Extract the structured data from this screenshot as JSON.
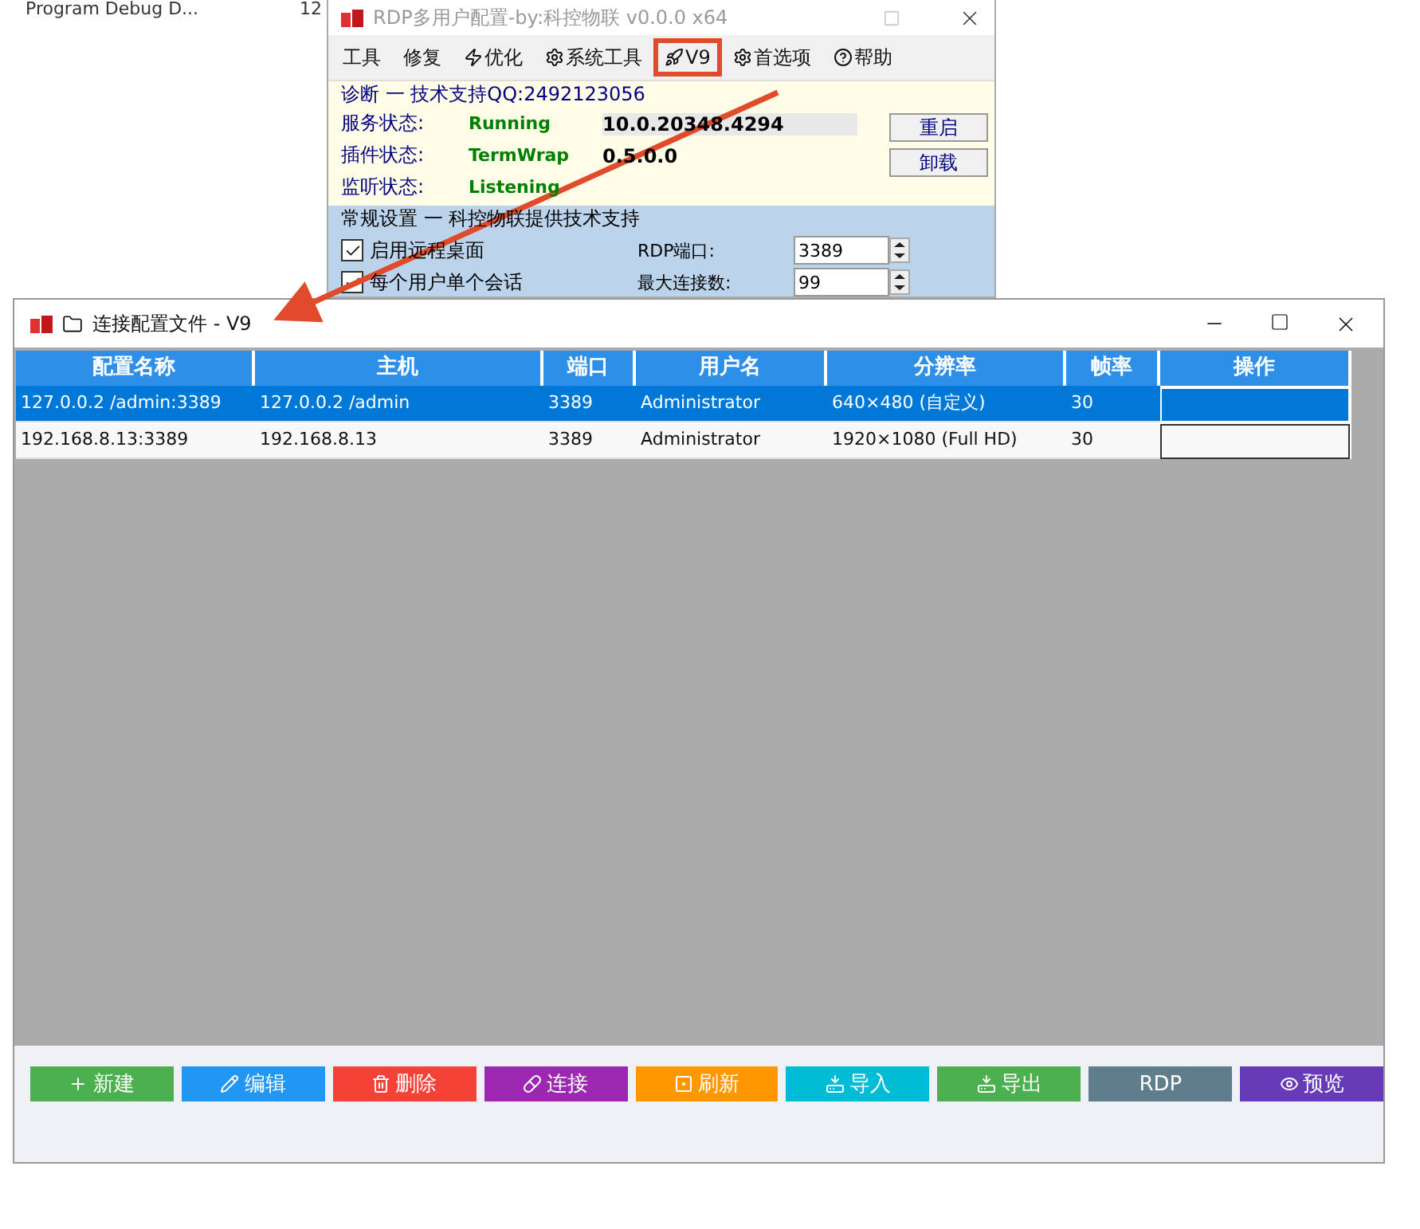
{
  "desktop": {
    "texts": [
      "Program Debug D...",
      "12"
    ]
  },
  "back_window": {
    "title": "RDP多用户配置-by:科控物联 v0.0.0 x64",
    "menu": [
      {
        "label": "工具",
        "annotated": false
      },
      {
        "label": "修复",
        "annotated": false
      },
      {
        "label": "优化",
        "annotated": false
      },
      {
        "label": "系统工具",
        "annotated": false
      },
      {
        "label": "V9",
        "annotated": true
      },
      {
        "label": "首选项",
        "annotated": false
      },
      {
        "label": "帮助",
        "annotated": false
      }
    ],
    "diagnostics": {
      "title": "诊断 一 技术支持QQ:2492123056",
      "rows": [
        {
          "label": "服务状态:",
          "status": "Running",
          "value": "10.0.20348.4294"
        },
        {
          "label": "插件状态:",
          "status": "TermWrap",
          "value": "0.5.0.0"
        },
        {
          "label": "监听状态:",
          "status": "Listening"
        }
      ],
      "buttons": [
        "重启",
        "卸载"
      ]
    },
    "settings": {
      "title": "常规设置 一 科控物联提供技术支持",
      "options": [
        {
          "label": "启用远程桌面",
          "checked": true
        },
        {
          "label": "每个用户单个会话",
          "checked": true
        }
      ],
      "fields": [
        {
          "label": "RDP端口:",
          "value": "3389"
        },
        {
          "label": "最大连接数:",
          "value": "99"
        }
      ]
    }
  },
  "front_window": {
    "title": "连接配置文件 - V9",
    "table": {
      "columns": [
        "配置名称",
        "主机",
        "端口",
        "用户名",
        "分辨率",
        "帧率",
        "操作"
      ],
      "rows": [
        {
          "cells": [
            "127.0.0.2 /admin:3389",
            "127.0.0.2 /admin",
            "3389",
            "Administrator",
            "640×480 (自定义)",
            "30"
          ],
          "selected": true
        },
        {
          "cells": [
            "192.168.8.13:3389",
            "192.168.8.13",
            "3389",
            "Administrator",
            "1920×1080 (Full HD)",
            "30"
          ],
          "selected": false
        }
      ]
    },
    "buttons": [
      {
        "label": "新建",
        "color": "#4caf50"
      },
      {
        "label": "编辑",
        "color": "#2196f3"
      },
      {
        "label": "删除",
        "color": "#f44336"
      },
      {
        "label": "连接",
        "color": "#9c27b0"
      },
      {
        "label": "刷新",
        "color": "#ff9800"
      },
      {
        "label": "导入",
        "color": "#00bcd4"
      },
      {
        "label": "导出",
        "color": "#4caf50"
      },
      {
        "label": "RDP",
        "color": "#607d8b"
      },
      {
        "label": "预览",
        "color": "#673ab7"
      }
    ]
  }
}
